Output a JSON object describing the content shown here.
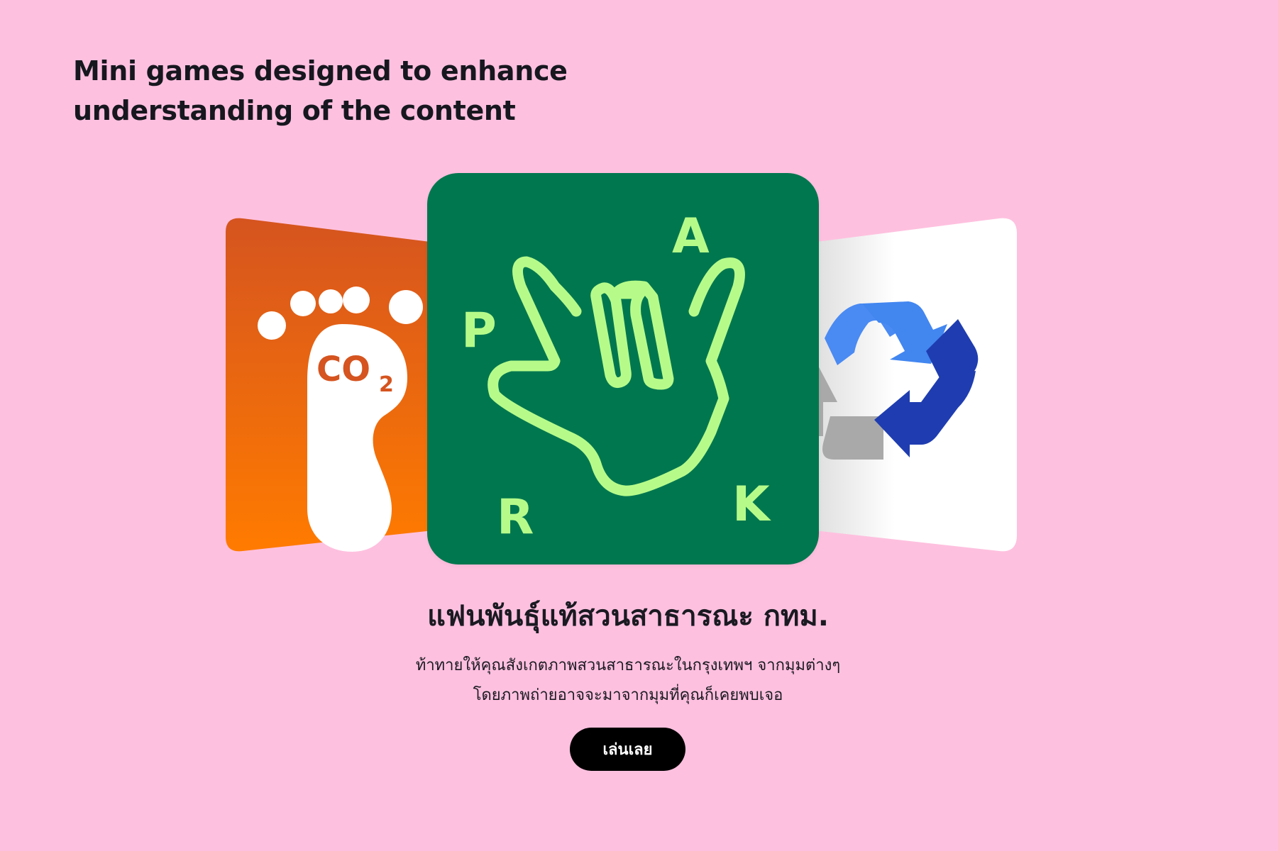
{
  "headline": {
    "line1": "Mini games designed to enhance",
    "line2": "understanding of the content"
  },
  "cards": {
    "left": {
      "icon": "co2-footprint-icon",
      "label": "CO",
      "subscript": "2",
      "color": "#f07b13"
    },
    "center": {
      "icon": "hand-sign-park-icon",
      "letters": {
        "a": "A",
        "p": "P",
        "r": "R",
        "k": "K"
      },
      "bg": "#00774f",
      "accent": "#b6fb8a"
    },
    "right": {
      "icon": "recycle-icon",
      "colors": [
        "#4286f0",
        "#1f3db0",
        "#a9a9a9"
      ]
    }
  },
  "game": {
    "title": "แฟนพันธุ์แท้สวนสาธารณะ กทม.",
    "description_line1": "ท้าทายให้คุณสังเกตภาพสวนสาธารณะในกรุงเทพฯ จากมุมต่างๆ",
    "description_line2": "โดยภาพถ่ายอาจจะมาจากมุมที่คุณก็เคยพบเจอ",
    "play_label": "เล่นเลย"
  }
}
